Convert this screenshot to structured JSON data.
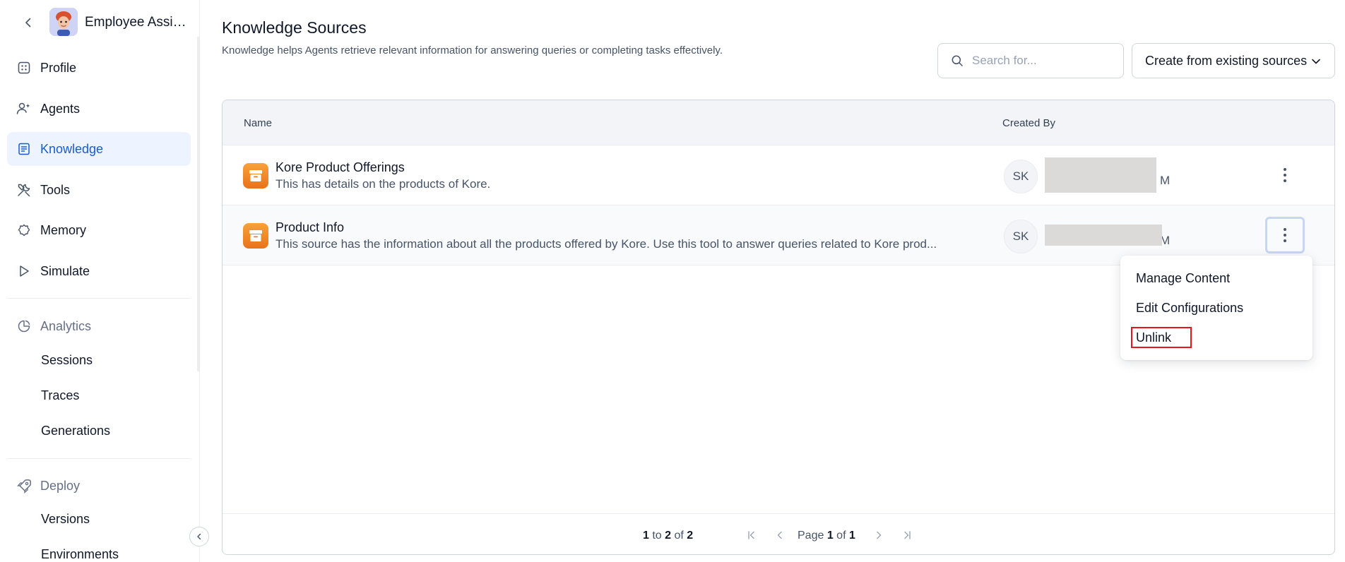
{
  "app": {
    "title": "Employee Assist..."
  },
  "sidebar": {
    "items": [
      {
        "label": "Profile",
        "icon": "grid-icon"
      },
      {
        "label": "Agents",
        "icon": "agents-icon"
      },
      {
        "label": "Knowledge",
        "icon": "document-icon",
        "active": true
      },
      {
        "label": "Tools",
        "icon": "tools-icon"
      },
      {
        "label": "Memory",
        "icon": "memory-icon"
      },
      {
        "label": "Simulate",
        "icon": "play-icon"
      }
    ],
    "analytics": {
      "label": "Analytics",
      "children": [
        "Sessions",
        "Traces",
        "Generations"
      ]
    },
    "deploy": {
      "label": "Deploy",
      "children": [
        "Versions",
        "Environments"
      ]
    }
  },
  "main": {
    "title": "Knowledge Sources",
    "description": "Knowledge helps Agents retrieve relevant information for answering queries or completing tasks effectively.",
    "search_placeholder": "Search for...",
    "create_button": "Create from existing sources",
    "table": {
      "columns": [
        "Name",
        "Created By"
      ],
      "rows": [
        {
          "name": "Kore Product Offerings",
          "description": "This has details on the products of Kore.",
          "initials": "SK",
          "creator_visible": "M"
        },
        {
          "name": "Product Info",
          "description": "This source has the information about all the products offered by Kore. Use this tool to answer queries related to Kore prod...",
          "initials": "SK",
          "creator_visible": "M"
        }
      ]
    },
    "menu": [
      "Manage Content",
      "Edit Configurations",
      "Unlink"
    ],
    "pagination": {
      "from": "1",
      "to": "2",
      "total": "2",
      "page": "1",
      "pages": "1"
    }
  },
  "colors": {
    "accent": "#175cd3",
    "active_bg": "#eef4ff",
    "highlight": "#e5161d",
    "source_icon": "#f08a24"
  }
}
